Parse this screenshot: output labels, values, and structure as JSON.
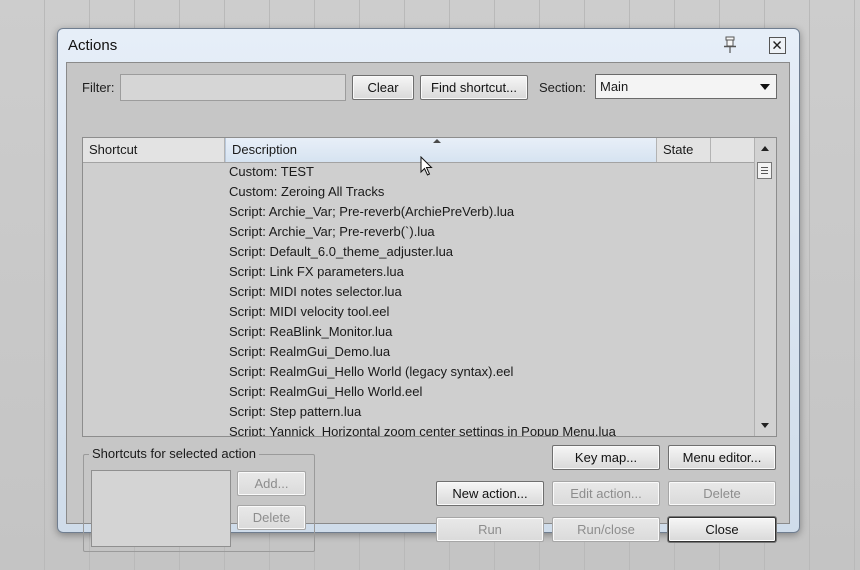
{
  "window": {
    "title": "Actions"
  },
  "filter": {
    "label": "Filter:",
    "value": "",
    "clear": "Clear",
    "find_shortcut": "Find shortcut..."
  },
  "section": {
    "label": "Section:",
    "selected": "Main"
  },
  "list": {
    "columns": [
      "Shortcut",
      "Description",
      "State"
    ],
    "rows": [
      "Custom: TEST",
      "Custom: Zeroing All Tracks",
      "Script: Archie_Var; Pre-reverb(ArchiePreVerb).lua",
      "Script: Archie_Var; Pre-reverb(`).lua",
      "Script: Default_6.0_theme_adjuster.lua",
      "Script: Link FX parameters.lua",
      "Script: MIDI notes selector.lua",
      "Script: MIDI velocity tool.eel",
      "Script: ReaBlink_Monitor.lua",
      "Script: RealmGui_Demo.lua",
      "Script: RealmGui_Hello World (legacy syntax).eel",
      "Script: RealmGui_Hello World.eel",
      "Script: Step pattern.lua",
      "Script: Yannick_Horizontal zoom center settings in Popup Menu.lua"
    ]
  },
  "shortcuts_group": {
    "title": "Shortcuts for selected action",
    "add": "Add...",
    "delete": "Delete"
  },
  "buttons": {
    "key_map": "Key map...",
    "menu_editor": "Menu editor...",
    "new_action": "New action...",
    "edit_action": "Edit action...",
    "delete": "Delete",
    "run": "Run",
    "run_close": "Run/close",
    "close": "Close"
  }
}
